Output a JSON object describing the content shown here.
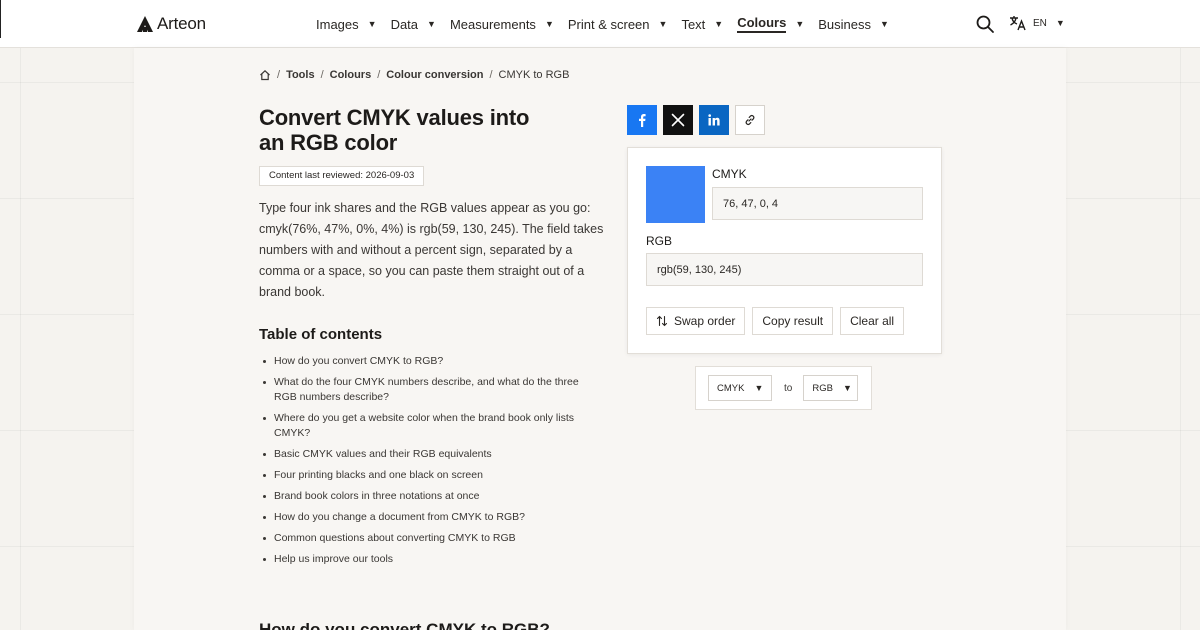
{
  "header": {
    "brand": "Arteon",
    "nav": [
      {
        "label": "Images",
        "active": false
      },
      {
        "label": "Data",
        "active": false
      },
      {
        "label": "Measurements",
        "active": false
      },
      {
        "label": "Print & screen",
        "active": false
      },
      {
        "label": "Text",
        "active": false
      },
      {
        "label": "Colours",
        "active": true
      },
      {
        "label": "Business",
        "active": false
      }
    ],
    "search_icon": "search-icon",
    "language_code": "EN"
  },
  "breadcrumb": {
    "home_icon": "home-icon",
    "items": [
      "Tools",
      "Colours",
      "Colour conversion",
      "CMYK to RGB"
    ]
  },
  "article": {
    "title": "Convert CMYK values into an RGB color",
    "reviewed": "Content last reviewed: 2026-09-03",
    "intro": "Type four ink shares and the RGB values appear as you go: cmyk(76%, 47%, 0%, 4%) is rgb(59, 130, 245). The field takes numbers with and without a percent sign, separated by a comma or a space, so you can paste them straight out of a brand book.",
    "toc_title": "Table of contents",
    "toc": [
      "How do you convert CMYK to RGB?",
      "What do the four CMYK numbers describe, and what do the three RGB numbers describe?",
      "Where do you get a website color when the brand book only lists CMYK?",
      "Basic CMYK values and their RGB equivalents",
      "Four printing blacks and one black on screen",
      "Brand book colors in three notations at once",
      "How do you change a document from CMYK to RGB?",
      "Common questions about converting CMYK to RGB",
      "Help us improve our tools"
    ],
    "next_heading": "How do you convert CMYK to RGB?"
  },
  "share": {
    "icons": [
      "facebook-icon",
      "x-icon",
      "linkedin-icon",
      "link-icon"
    ],
    "colors": {
      "facebook": "#1877f2",
      "x": "#111111",
      "linkedin": "#0a66c2"
    }
  },
  "converter": {
    "swatch_color": "#3b82f5",
    "cmyk_label": "CMYK",
    "cmyk_value": "76, 47, 0, 4",
    "rgb_label": "RGB",
    "rgb_value": "rgb(59, 130, 245)",
    "swap_label": "Swap order",
    "copy_label": "Copy result",
    "clear_label": "Clear all"
  },
  "selector": {
    "from": "CMYK",
    "to_label": "to",
    "to": "RGB"
  }
}
